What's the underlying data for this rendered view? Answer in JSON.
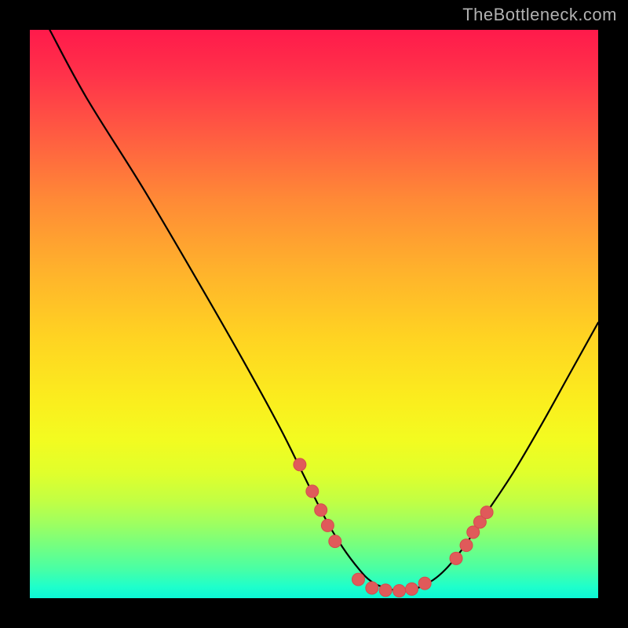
{
  "watermark": "TheBottleneck.com",
  "colors": {
    "curve": "#000000",
    "marker_fill": "#e05a5a",
    "marker_stroke": "#d44c4c",
    "background_border": "#000000"
  },
  "chart_data": {
    "type": "line",
    "title": "",
    "xlabel": "",
    "ylabel": "",
    "xlim": [
      0,
      100
    ],
    "ylim": [
      0,
      100
    ],
    "grid": false,
    "legend": false,
    "series": [
      {
        "name": "curve",
        "x": [
          3.5,
          10,
          20,
          30,
          38,
          44,
          48,
          52,
          55,
          58,
          60,
          62,
          65,
          68,
          72,
          76,
          80,
          85,
          90,
          95,
          100
        ],
        "y": [
          100,
          88,
          72,
          55,
          41,
          30,
          22,
          14,
          9,
          5,
          3,
          2,
          1.3,
          1.7,
          4,
          8.5,
          14.5,
          22,
          30.5,
          39.5,
          48.5
        ]
      }
    ],
    "markers": [
      {
        "x": 47.5,
        "y": 23.5
      },
      {
        "x": 49.7,
        "y": 18.8
      },
      {
        "x": 51.2,
        "y": 15.5
      },
      {
        "x": 52.4,
        "y": 12.8
      },
      {
        "x": 53.7,
        "y": 10.0
      },
      {
        "x": 57.8,
        "y": 3.3
      },
      {
        "x": 60.2,
        "y": 1.8
      },
      {
        "x": 62.6,
        "y": 1.4
      },
      {
        "x": 65.0,
        "y": 1.3
      },
      {
        "x": 67.2,
        "y": 1.6
      },
      {
        "x": 69.5,
        "y": 2.6
      },
      {
        "x": 75.0,
        "y": 7.0
      },
      {
        "x": 76.8,
        "y": 9.3
      },
      {
        "x": 78.0,
        "y": 11.6
      },
      {
        "x": 79.2,
        "y": 13.4
      },
      {
        "x": 80.4,
        "y": 15.1
      }
    ],
    "marker_radius_px": 8
  }
}
